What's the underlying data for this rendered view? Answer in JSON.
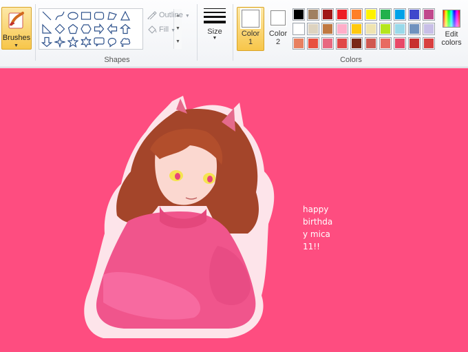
{
  "ribbon": {
    "brushes_label": "Brushes",
    "shapes_label": "Shapes",
    "outline_label": "Outline",
    "fill_label": "Fill",
    "size_label": "Size",
    "color1_label": "Color\n1",
    "color2_label": "Color\n2",
    "colors_label": "Colors",
    "edit_colors_label": "Edit\ncolors",
    "shapes": [
      "line-icon",
      "curve-icon",
      "oval-icon",
      "rectangle-icon",
      "rounded-rectangle-icon",
      "polygon-icon",
      "triangle-icon",
      "right-triangle-icon",
      "diamond-icon",
      "pentagon-icon",
      "hexagon-icon",
      "right-arrow-icon",
      "left-arrow-icon",
      "up-arrow-icon",
      "down-arrow-icon",
      "four-point-star-icon",
      "five-point-star-icon",
      "six-point-star-icon",
      "rounded-callout-icon",
      "oval-callout-icon",
      "cloud-callout-icon"
    ],
    "color1": "#ffffff",
    "color2": "#ffffff",
    "palette_row1": [
      "#000000",
      "#a08060",
      "#a01818",
      "#ed1c24",
      "#ff7f27",
      "#fff200",
      "#22b14c",
      "#00a2e8",
      "#3f48cc",
      "#c0488c"
    ],
    "palette_row2": [
      "#ffffff",
      "#ddd3c0",
      "#c07840",
      "#ffaec9",
      "#ffc90e",
      "#efe4b0",
      "#b5e61d",
      "#99d9ea",
      "#7092be",
      "#c8bfe7"
    ],
    "palette_row3": [
      "#e88060",
      "#e85040",
      "#e86880",
      "#e04848",
      "#7a2a18",
      "#d05850",
      "#e86a60",
      "#e84868",
      "#c83030",
      "#d84040"
    ]
  },
  "canvas": {
    "background": "#fe4d80",
    "text": "happy\nbirthda\ny mica\n11!!"
  }
}
